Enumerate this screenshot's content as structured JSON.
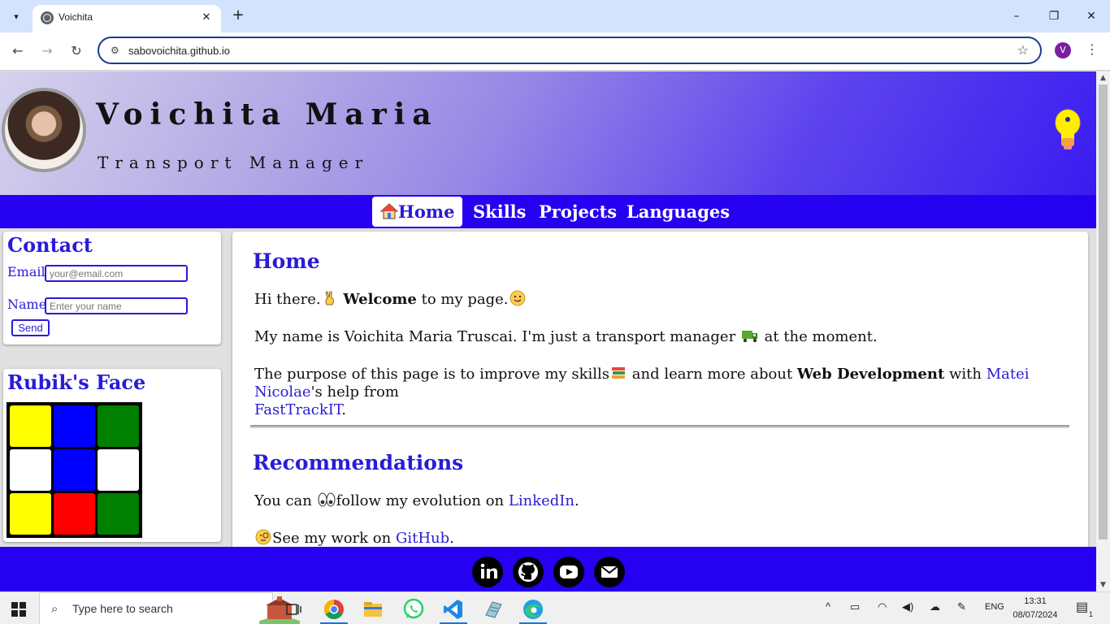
{
  "browser": {
    "tab_title": "Voichita",
    "url": "sabovoichita.github.io",
    "profile_initial": "V"
  },
  "hero": {
    "name": "Voichita Maria",
    "role": "Transport Manager"
  },
  "nav": {
    "items": [
      {
        "label": "Home",
        "icon": "house-icon",
        "active": true
      },
      {
        "label": "Skills"
      },
      {
        "label": "Projects"
      },
      {
        "label": "Languages"
      }
    ]
  },
  "contact": {
    "title": "Contact",
    "email_label": "Email",
    "email_placeholder": "your@email.com",
    "name_label": "Name",
    "name_placeholder": "Enter your name",
    "send_label": "Send"
  },
  "rubik": {
    "title": "Rubik's Face",
    "squares": [
      "#ffff00",
      "#0000ff",
      "#008000",
      "#ffffff",
      "#0000ff",
      "#ffffff",
      "#ffff00",
      "#ff0000",
      "#008000"
    ]
  },
  "content": {
    "home_title": "Home",
    "p1_a": "Hi there.",
    "p1_b": "Welcome",
    "p1_c": " to my page.",
    "p2_a": "My name is Voichita Maria Truscai. I'm just a transport manager ",
    "p2_b": " at the moment.",
    "p3_a": "The purpose of this page is to improve my skills",
    "p3_b": " and learn more about ",
    "p3_c": "Web Development",
    "p3_d": " with ",
    "p3_link1": "Matei Nicolae",
    "p3_e": "'s help from",
    "p3_link2": "FastTrackIT",
    "p3_f": ".",
    "rec_title": "Recommendations",
    "r1_a": "You can ",
    "r1_b": "follow my evolution on ",
    "r1_link": "LinkedIn",
    "r1_c": ".",
    "r2_a": "See my work on ",
    "r2_link": "GitHub",
    "r2_b": "."
  },
  "footer": {
    "icons": [
      "linkedin-icon",
      "github-icon",
      "youtube-icon",
      "email-icon"
    ]
  },
  "taskbar": {
    "search_placeholder": "Type here to search",
    "lang": "ENG",
    "time": "13:31",
    "date": "08/07/2024",
    "notification_count": "1"
  },
  "colors": {
    "accent": "#2a1bd6",
    "nav_bg": "#2600f0"
  }
}
